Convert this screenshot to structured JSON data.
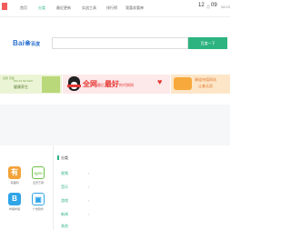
{
  "nav": {
    "items": [
      "首页",
      "分类",
      "最近更新",
      "实战工具",
      "排行榜",
      "我喜欢看神"
    ],
    "date_day": "12",
    "date_sep": "月",
    "date_month": "09",
    "date_extra": "08:03"
  },
  "search": {
    "brand_text": "Bai",
    "brand_paw": "❀",
    "brand_suffix": "百度",
    "placeholder": "",
    "button_label": "百度一下"
  },
  "banners": {
    "left_tag": "自我 无敌",
    "left_line1": "DM-19 NZ NEO",
    "left_line2": "健康养生",
    "mid_text_a": "全网",
    "mid_text_b": "最后",
    "mid_text_c": "最好",
    "mid_text_d": "的代刷网",
    "right_line1": "康道充值网站",
    "right_line2": "让美无双"
  },
  "apps": [
    {
      "glyph": "有",
      "label": "有趣网",
      "color": "#f2a33a"
    },
    {
      "glyph": "iQIYI",
      "label": "爱奇艺网",
      "color": "#6ec04a"
    },
    {
      "glyph": "B",
      "label": "哔哩哔哩",
      "color": "#2fa5e8"
    },
    {
      "glyph": "▣",
      "label": "广告软件",
      "color": "#2fa5e8"
    }
  ],
  "categories": {
    "title": "分类",
    "items": [
      "视频",
      "音乐",
      "游戏",
      "游戏",
      "新闻",
      "其他"
    ],
    "arrow": "›"
  }
}
